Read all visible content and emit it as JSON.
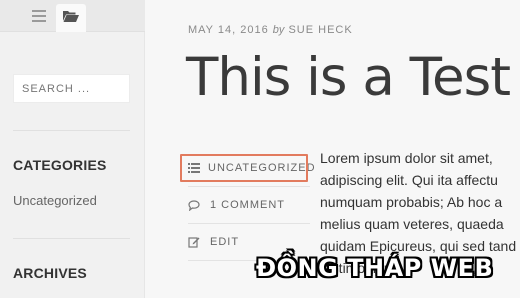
{
  "sidebar": {
    "tabs": [
      {
        "icon": "menu-icon"
      },
      {
        "icon": "folder-open-icon"
      }
    ],
    "search_placeholder": "SEARCH ...",
    "categories_heading": "CATEGORIES",
    "categories": [
      "Uncategorized"
    ],
    "archives_heading": "ARCHIVES"
  },
  "post": {
    "date": "MAY 14, 2016",
    "by": "by",
    "author": "SUE HECK",
    "title": "This is a Test",
    "meta": {
      "category": "UNCATEGORIZED",
      "comments": "1 COMMENT",
      "edit": "EDIT"
    },
    "excerpt_lines": [
      "Lorem ipsum dolor sit amet,",
      "adipiscing elit. Qui ita affectu",
      "numquam probabis; Ab hoc a",
      "melius quam veteres, quaeda",
      "quidam Epicureus, qui sed tand",
      "testimonium"
    ]
  },
  "colors": {
    "highlight": "#e27b5e",
    "sidebar_bg": "#f1f1f1"
  },
  "watermark": "ĐỒNG THÁP WEB"
}
